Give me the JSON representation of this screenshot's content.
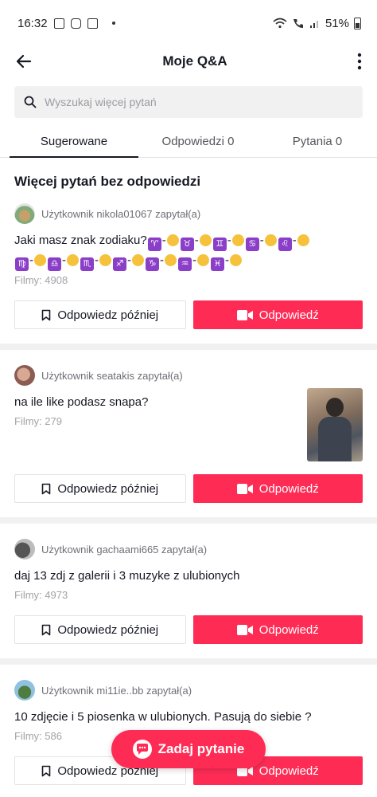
{
  "status_bar": {
    "time": "16:32",
    "battery": "51%"
  },
  "header": {
    "title": "Moje Q&A"
  },
  "search": {
    "placeholder": "Wyszukaj więcej pytań"
  },
  "tabs": [
    {
      "label": "Sugerowane",
      "active": true
    },
    {
      "label": "Odpowiedzi 0",
      "active": false
    },
    {
      "label": "Pytania 0",
      "active": false
    }
  ],
  "section_title": "Więcej pytań bez odpowiedzi",
  "buttons": {
    "later": "Odpowiedz później",
    "answer": "Odpowiedź"
  },
  "questions": [
    {
      "asker": "Użytkownik nikola01067 zapytał(a)",
      "question": "Jaki masz znak zodiaku?♈-👌♉-👈♊-🤌♋-🤟♌-🤟♍-👋♎-✋♏-✌️♐-🫵♑-🤘♒-👆♓-✌️",
      "question_prefix": "Jaki masz znak zodiaku?",
      "films": "Filmy: 4908"
    },
    {
      "asker": "Użytkownik seatakis zapytał(a)",
      "question": "na ile like podasz snapa?",
      "films": "Filmy: 279"
    },
    {
      "asker": "Użytkownik gachaami665 zapytał(a)",
      "question": "daj 13 zdj z galerii i 3 muzyke z ulubionych",
      "films": "Filmy: 4973"
    },
    {
      "asker": "Użytkownik mi11ie..bb zapytał(a)",
      "question": "10 zdjęcie i 5 piosenka w ulubionych. Pasują do siebie ?",
      "films": "Filmy: 586"
    }
  ],
  "fab": {
    "label": "Zadaj pytanie"
  },
  "colors": {
    "accent": "#fe2c55",
    "text": "#161823",
    "muted": "#a2a3a8"
  }
}
